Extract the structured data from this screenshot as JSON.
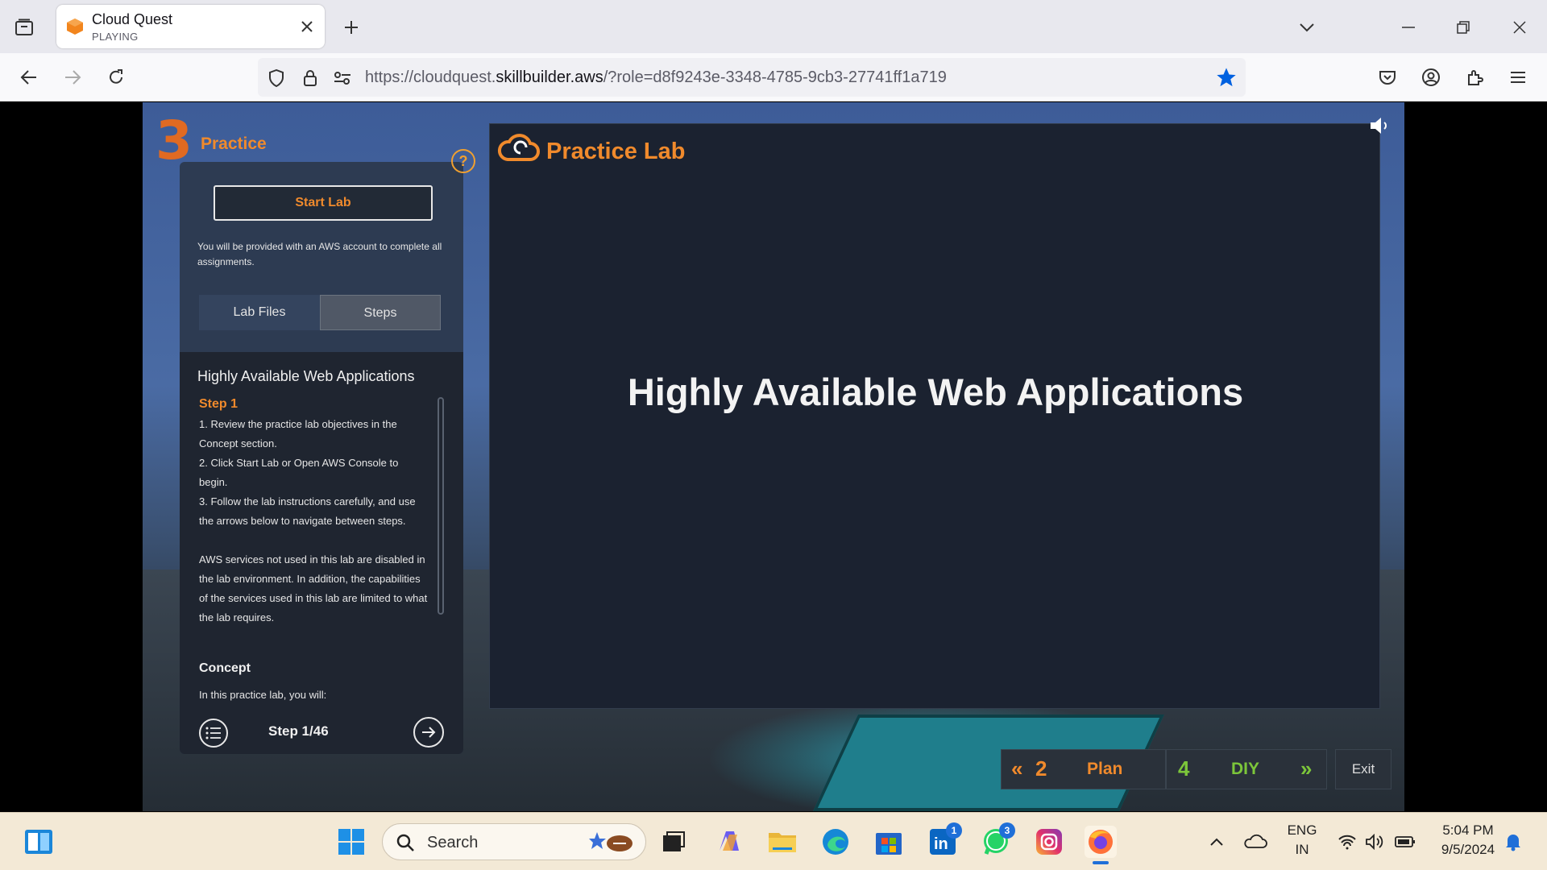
{
  "browser": {
    "tab": {
      "title": "Cloud Quest",
      "status": "PLAYING"
    },
    "url": {
      "prefix": "https://cloudquest.",
      "domain": "skillbuilder.aws",
      "path": "/?role=d8f9243e-3348-4785-9cb3-27741ff1a719"
    }
  },
  "game": {
    "header": {
      "number": "3",
      "label": "Practice",
      "help": "?"
    },
    "start_lab": "Start Lab",
    "provided_text": "You will be provided with an AWS account to complete all assignments.",
    "tabs": [
      {
        "label": "Lab Files"
      },
      {
        "label": "Steps"
      }
    ],
    "steps": {
      "title": "Highly Available Web Applications",
      "step_label": "Step 1",
      "lines": [
        "1. Review the practice lab objectives in the Concept section.",
        "2. Click Start Lab or Open AWS Console to begin.",
        "3. Follow the lab instructions carefully, and use the arrows below to navigate between steps."
      ],
      "note": "AWS services not used in this lab are disabled in the lab environment. In addition, the capabilities of the services used in this lab are limited to what the lab requires.",
      "concept_heading": "Concept",
      "concept_text": "In this practice lab, you will:",
      "counter": "Step 1/46"
    },
    "lab": {
      "logo_title": "Practice Lab",
      "heading": "Highly Available Web Applications"
    },
    "bottom": {
      "plan": {
        "arrows": "«",
        "number": "2",
        "label": "Plan"
      },
      "diy": {
        "number": "4",
        "label": "DIY",
        "arrows": "»"
      },
      "exit": "Exit"
    }
  },
  "taskbar": {
    "search_placeholder": "Search",
    "badges": {
      "linkedin": "1",
      "whatsapp": "3"
    },
    "lang": {
      "line1": "ENG",
      "line2": "IN"
    },
    "time": "5:04 PM",
    "date": "9/5/2024"
  },
  "colors": {
    "accent": "#f08a2c",
    "diy_green": "#7cc63a",
    "panel": "#2d3b52"
  }
}
